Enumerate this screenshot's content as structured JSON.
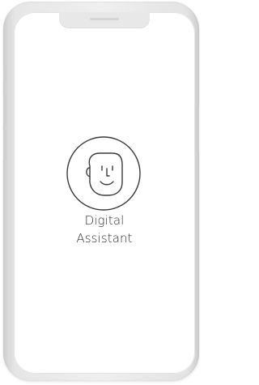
{
  "app": {
    "label_line_1": "Digital",
    "label_line_2": "Assistant",
    "icon": "face-profile-icon"
  }
}
